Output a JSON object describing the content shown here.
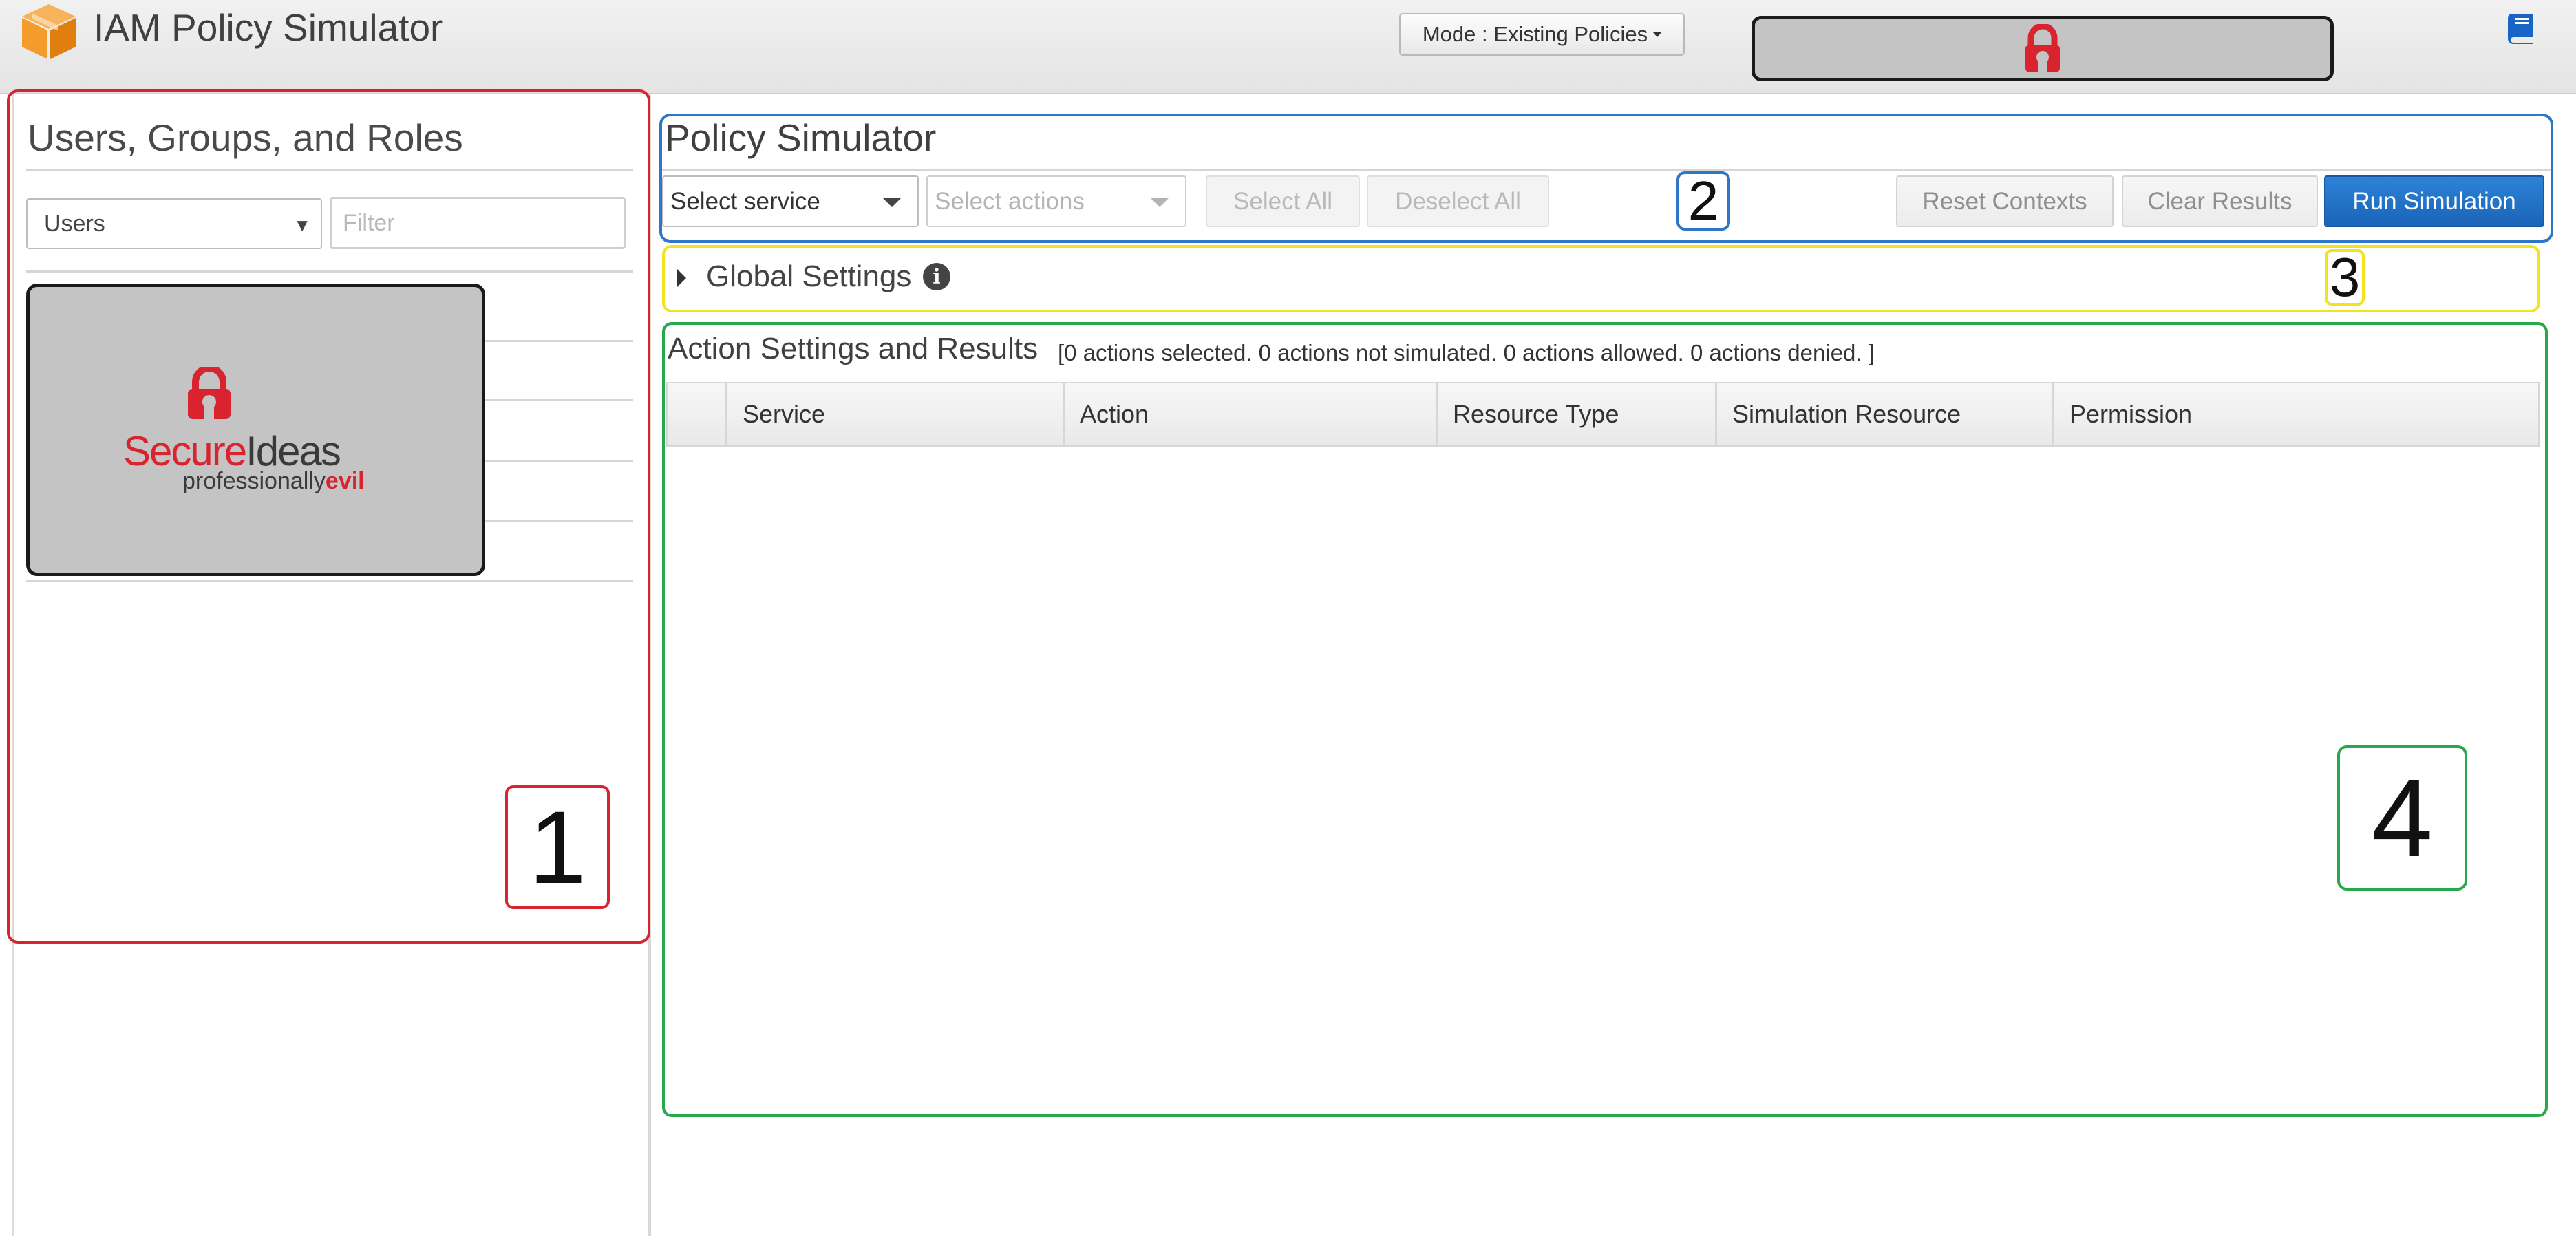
{
  "header": {
    "title": "IAM Policy Simulator",
    "mode_button": "Mode : Existing Policies",
    "logo_icon": "aws-cube-icon",
    "help_icon": "book-icon"
  },
  "left_panel": {
    "heading": "Users, Groups, and Roles",
    "entity_type": {
      "selected": "Users",
      "options": [
        "Users"
      ]
    },
    "filter_placeholder": "Filter",
    "logo_text": {
      "primary": "Secure",
      "secondary": "Ideas",
      "tagline": "professionally",
      "tagline_accent": "evil"
    },
    "marker": "1"
  },
  "simulator": {
    "title": "Policy Simulator",
    "service_select": "Select service",
    "actions_select": "Select actions",
    "buttons": {
      "select_all": "Select All",
      "deselect_all": "Deselect All",
      "reset_contexts": "Reset Contexts",
      "clear_results": "Clear Results",
      "run_simulation": "Run Simulation"
    },
    "marker": "2"
  },
  "global_settings": {
    "label": "Global Settings",
    "info_icon": "info-circle-icon",
    "marker": "3"
  },
  "results": {
    "title": "Action Settings and Results",
    "summary": "[0 actions selected. 0 actions not simulated. 0 actions allowed. 0 actions denied. ]",
    "columns": [
      "Service",
      "Action",
      "Resource Type",
      "Simulation Resource",
      "Permission"
    ],
    "rows": [],
    "marker": "4"
  },
  "colors": {
    "region_1": "#d9232e",
    "region_2": "#2d76c8",
    "region_3": "#f1e31f",
    "region_4": "#27a84a",
    "primary_button": "#1a64b8",
    "brand_red": "#d9232e",
    "aws_orange": "#f39c2c"
  }
}
